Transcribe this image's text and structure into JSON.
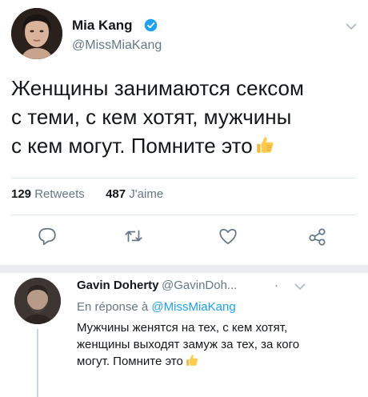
{
  "tweet": {
    "author_name": "Mia Kang",
    "handle": "@MissMiaKang",
    "text_lines": [
      "Женщины занимаются сексом",
      "с теми, с кем хотят, мужчины",
      "с кем могут. Помните это"
    ],
    "retweets_count": "129",
    "retweets_label": "Retweets",
    "likes_count": "487",
    "likes_label": "J'aime"
  },
  "reply": {
    "author_name": "Gavin Doherty",
    "handle": "@GavinDoh...",
    "dot": "·",
    "reply_to_prefix": "En réponse à",
    "reply_to_handle": "@MissMiaKang",
    "text_lines": [
      "Мужчины женятся на тех, с кем хотят,",
      "женщины выходят замуж за тех, за кого",
      "могут. Помните это"
    ]
  },
  "icons": {
    "verified": "verified-badge-icon",
    "reply": "reply-icon",
    "retweet": "retweet-icon",
    "like": "like-icon",
    "share": "share-icon",
    "thumbs_up": "thumbs-up-emoji"
  },
  "colors": {
    "accent": "#1da1f2",
    "muted": "#657786",
    "text": "#14171a",
    "divider": "#e1e8ed",
    "separator": "#e6ecf0"
  }
}
